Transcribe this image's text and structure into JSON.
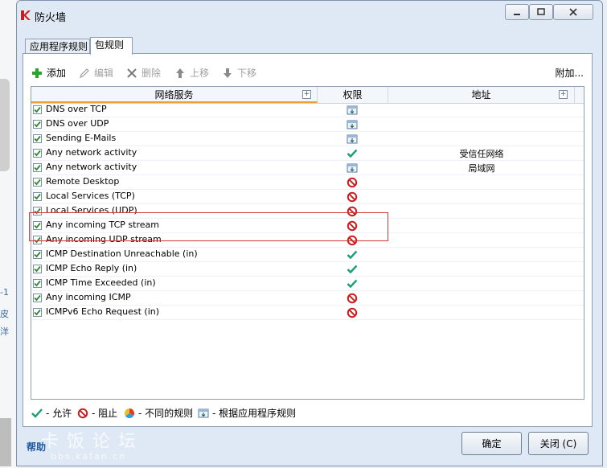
{
  "window": {
    "title": "防火墙"
  },
  "tabs": [
    {
      "label": "应用程序规则",
      "active": false
    },
    {
      "label": "包规则",
      "active": true
    }
  ],
  "toolbar": {
    "add": "添加",
    "edit": "编辑",
    "delete": "删除",
    "up": "上移",
    "down": "下移",
    "attach": "附加..."
  },
  "columns": {
    "service": "网络服务",
    "permission": "权限",
    "address": "地址"
  },
  "rules": [
    {
      "name": "DNS over TCP",
      "checked": true,
      "permission": "app-rule",
      "address": ""
    },
    {
      "name": "DNS over UDP",
      "checked": true,
      "permission": "app-rule",
      "address": ""
    },
    {
      "name": "Sending E-Mails",
      "checked": true,
      "permission": "app-rule",
      "address": ""
    },
    {
      "name": "Any network activity",
      "checked": true,
      "permission": "allow",
      "address": "受信任网络"
    },
    {
      "name": "Any network activity",
      "checked": true,
      "permission": "app-rule",
      "address": "局域网"
    },
    {
      "name": "Remote Desktop",
      "checked": true,
      "permission": "block",
      "address": ""
    },
    {
      "name": "Local Services (TCP)",
      "checked": true,
      "permission": "block",
      "address": ""
    },
    {
      "name": "Local Services (UDP)",
      "checked": true,
      "permission": "block",
      "address": ""
    },
    {
      "name": "Any incoming TCP stream",
      "checked": true,
      "permission": "block",
      "address": ""
    },
    {
      "name": "Any incoming UDP stream",
      "checked": true,
      "permission": "block",
      "address": ""
    },
    {
      "name": "ICMP Destination Unreachable (in)",
      "checked": true,
      "permission": "allow",
      "address": ""
    },
    {
      "name": "ICMP Echo Reply (in)",
      "checked": true,
      "permission": "allow",
      "address": ""
    },
    {
      "name": "ICMP Time Exceeded (in)",
      "checked": true,
      "permission": "allow",
      "address": ""
    },
    {
      "name": "Any incoming ICMP",
      "checked": true,
      "permission": "block",
      "address": ""
    },
    {
      "name": "ICMPv6 Echo Request (in)",
      "checked": true,
      "permission": "block",
      "address": ""
    }
  ],
  "legend": {
    "allow": "- 允许",
    "block": "- 阻止",
    "mixed": "- 不同的规则",
    "app_rule": "- 根据应用程序规则"
  },
  "footer": {
    "help": "帮助",
    "ok": "确定",
    "close": "关闭 (C)"
  },
  "watermark": {
    "text": "卡饭论坛",
    "url": "bbs.kafan.cn"
  },
  "background_fragments": [
    "-1",
    "皮",
    "洋"
  ],
  "colors": {
    "allow": "#1a9e7a",
    "block": "#c81e1e",
    "highlight": "#d43c3c"
  }
}
